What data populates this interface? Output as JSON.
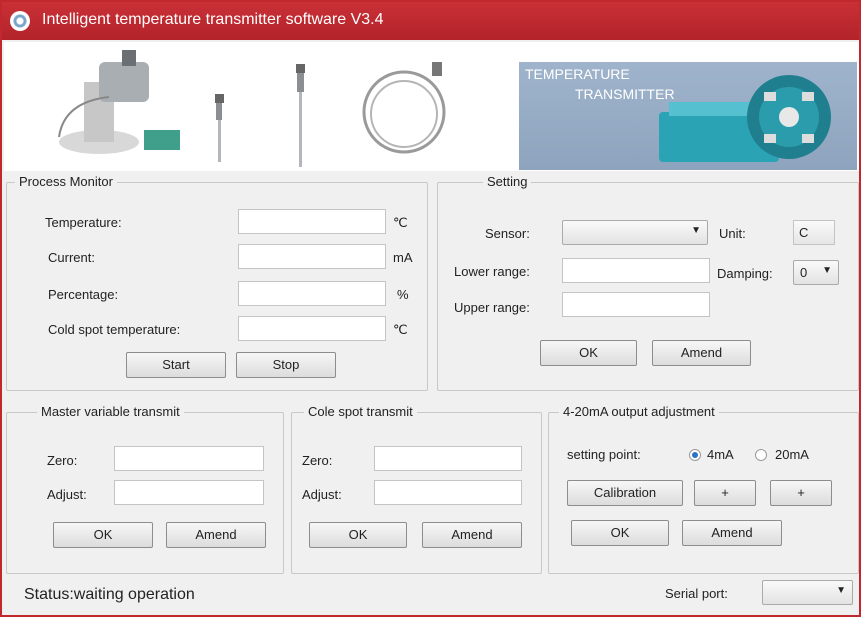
{
  "title": "Intelligent temperature transmitter software V3.4",
  "banner": {
    "line1": "TEMPERATURE",
    "line2": "TRANSMITTER"
  },
  "process_monitor": {
    "legend": "Process Monitor",
    "rows": [
      {
        "label": "Temperature:",
        "unit": "℃",
        "value": ""
      },
      {
        "label": "Current:",
        "unit": "mA",
        "value": ""
      },
      {
        "label": "Percentage:",
        "unit": "%",
        "value": ""
      },
      {
        "label": "Cold spot temperature:",
        "unit": "℃",
        "value": ""
      }
    ],
    "start_label": "Start",
    "stop_label": "Stop"
  },
  "setting": {
    "legend": "Setting",
    "sensor_label": "Sensor:",
    "sensor_value": "",
    "unit_label": "Unit:",
    "unit_value": "C",
    "lower_label": "Lower range:",
    "lower_value": "",
    "upper_label": "Upper range:",
    "upper_value": "",
    "damping_label": "Damping:",
    "damping_value": "0",
    "ok_label": "OK",
    "amend_label": "Amend"
  },
  "master": {
    "legend": "Master variable transmit",
    "zero_label": "Zero:",
    "zero_value": "",
    "adjust_label": "Adjust:",
    "adjust_value": "",
    "ok_label": "OK",
    "amend_label": "Amend"
  },
  "cold": {
    "legend": "Cole spot transmit",
    "zero_label": "Zero:",
    "zero_value": "",
    "adjust_label": "Adjust:",
    "adjust_value": "",
    "ok_label": "OK",
    "amend_label": "Amend"
  },
  "output": {
    "legend": "4-20mA output adjustment",
    "setting_point_label": "setting point:",
    "option_4ma": "4mA",
    "option_20ma": "20mA",
    "selected": "4mA",
    "calibration_label": "Calibration",
    "plus1_label": "+",
    "plus2_label": "+",
    "ok_label": "OK",
    "amend_label": "Amend"
  },
  "status": {
    "text": "Status:waiting operation"
  },
  "serial": {
    "label": "Serial port:",
    "value": ""
  },
  "colors": {
    "titlebar": "#c0282d",
    "banner_blue": "#9fb4cc",
    "radio_selected": "#2a74c8"
  }
}
